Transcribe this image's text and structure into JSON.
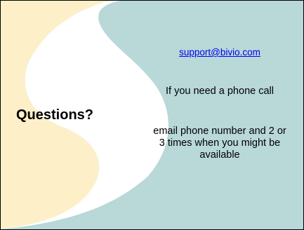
{
  "slide": {
    "heading": "Questions?",
    "email_link": "support@bivio.com",
    "phone_note": "If you need a phone call",
    "email_note": "email phone number and 2 or 3 times when you might be available"
  },
  "colors": {
    "background": "#b9d8d8",
    "yellow_shape": "#fdf0c8",
    "white_swoosh": "#ffffff",
    "link": "#0000ee",
    "text": "#000000"
  }
}
